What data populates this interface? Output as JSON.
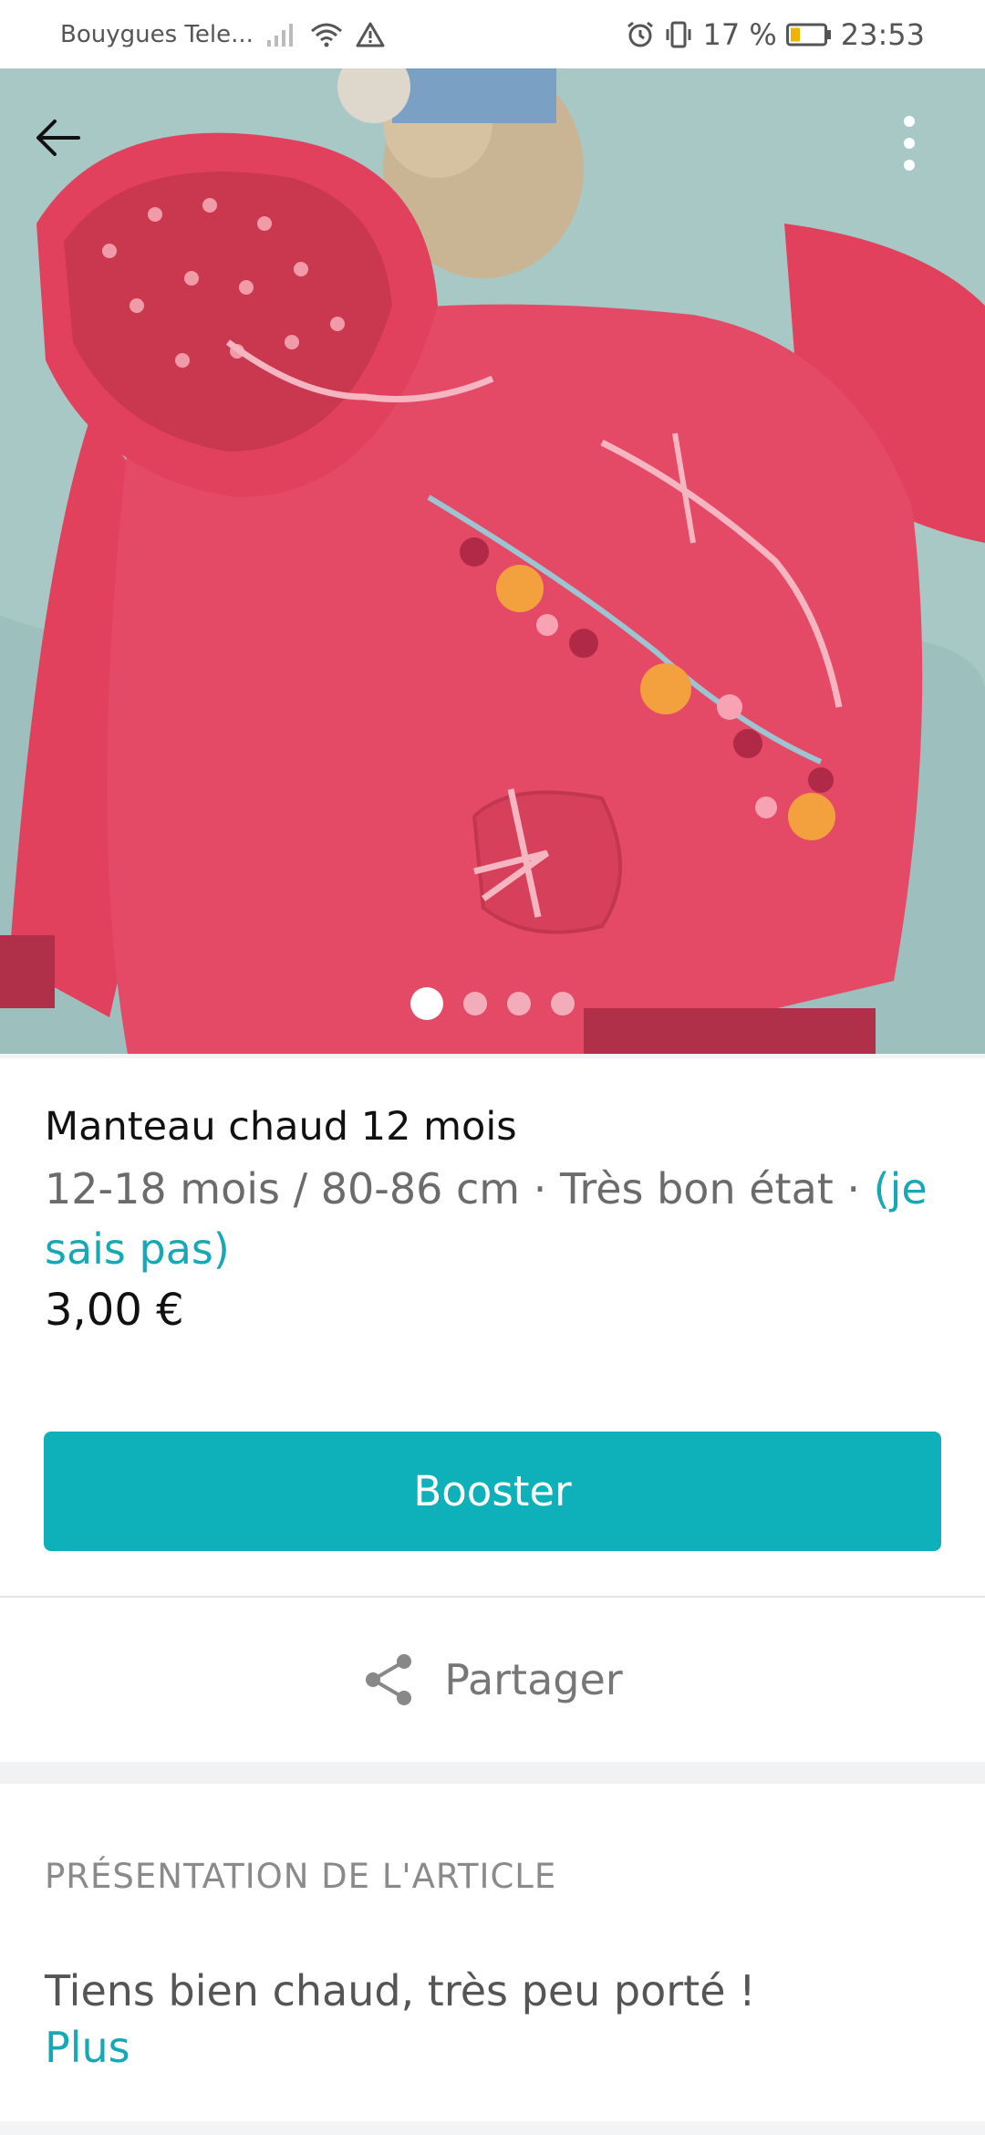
{
  "status_bar": {
    "carrier": "Bouygues Tele...",
    "battery": "17 %",
    "time": "23:53",
    "icons": [
      "signal-icon",
      "wifi-icon",
      "warning-icon",
      "alarm-icon",
      "vibrate-icon",
      "battery-icon"
    ]
  },
  "hero": {
    "icons": [
      "back-arrow-icon",
      "more-vert-icon"
    ],
    "pager": {
      "count": 4,
      "active": 1
    }
  },
  "item": {
    "title": "Manteau chaud 12 mois",
    "subtitle_prefix": "12-18 mois / 80-86 cm · Très bon état · ",
    "subtitle_link": "(je sais pas)",
    "price": "3,00 €"
  },
  "actions": {
    "boost_label": "Booster",
    "share_label": "Partager"
  },
  "description": {
    "heading": "PRÉSENTATION DE L'ARTICLE",
    "text": "Tiens bien chaud, très peu porté !",
    "more": "Plus"
  },
  "colors": {
    "accent": "#0eb1b9",
    "link": "#16a8b5",
    "jacket": "#e2415e"
  }
}
